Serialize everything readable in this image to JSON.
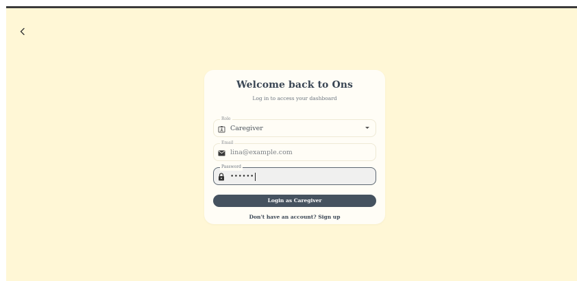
{
  "header": {
    "back_icon": "chevron-left-icon"
  },
  "login": {
    "title": "Welcome back to Ons",
    "subtitle": "Log in to access your dashboard",
    "role": {
      "label": "Role",
      "value": "Caregiver",
      "icon": "id-badge-icon"
    },
    "email": {
      "label": "Email",
      "placeholder": "lina@example.com",
      "icon": "envelope-icon"
    },
    "password": {
      "label": "Password",
      "value": "••••••",
      "icon": "lock-icon"
    },
    "submit_label": "Login as Caregiver",
    "signup_prompt": "Don't have an account? Sign up"
  },
  "colors": {
    "background": "#fff7d6",
    "card": "#fffdf6",
    "primary_button": "#45525f",
    "text": "#3a4654"
  }
}
